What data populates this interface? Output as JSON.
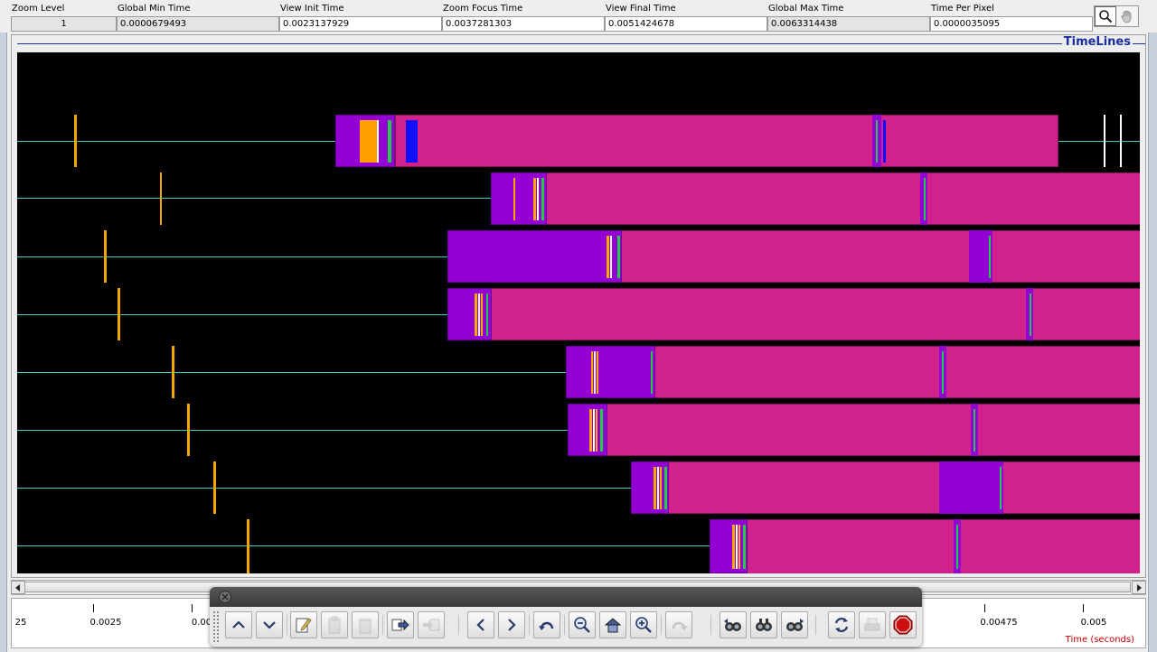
{
  "info": {
    "zoom_level_label": "Zoom Level",
    "zoom_level_value": "1",
    "global_min_label": "Global Min Time",
    "global_min_value": "0.0000679493",
    "view_init_label": "View  Init Time",
    "view_init_value": "0.0023137929",
    "zoom_focus_label": "Zoom Focus Time",
    "zoom_focus_value": "0.0037281303",
    "view_final_label": "View Final Time",
    "view_final_value": "0.0051424678",
    "global_max_label": "Global Max Time",
    "global_max_value": "0.0063314438",
    "time_per_pixel_label": "Time Per Pixel",
    "time_per_pixel_value": "0.0000035095"
  },
  "tools": [
    "magnifier-icon",
    "hand-icon"
  ],
  "panel": {
    "title": "TimeLines"
  },
  "colors": {
    "background": "#000000",
    "baseline": "#45c8d4",
    "event": "#f5a800",
    "state_purple": "#9400d3",
    "state_pink": "#d0218c",
    "marker_green": "#22cc44",
    "marker_blue": "#1010ff",
    "marker_white": "#ffffff",
    "axis_label": "#cc0000"
  },
  "ruler": {
    "ticks": [
      {
        "value": 0.00225,
        "label": "25"
      },
      {
        "value": 0.0025,
        "label": "0.0025"
      },
      {
        "value": 0.00275,
        "label": "0.00"
      },
      {
        "value": 0.00475,
        "label": "0.00475"
      },
      {
        "value": 0.005,
        "label": "0.005"
      }
    ],
    "axis_label": "Time (seconds)"
  },
  "float_toolbar": {
    "buttons": [
      "up-icon",
      "down-icon",
      "edit-icon",
      "clipboard-icon",
      "trash-icon",
      "export-icon",
      "import-icon",
      "back-icon",
      "forward-icon",
      "undo-icon",
      "zoom-out-icon",
      "home-icon",
      "zoom-in-icon",
      "redo-icon",
      "search-back-icon",
      "search-icon",
      "search-forward-icon",
      "refresh-icon",
      "print-icon",
      "stop-icon"
    ]
  }
}
